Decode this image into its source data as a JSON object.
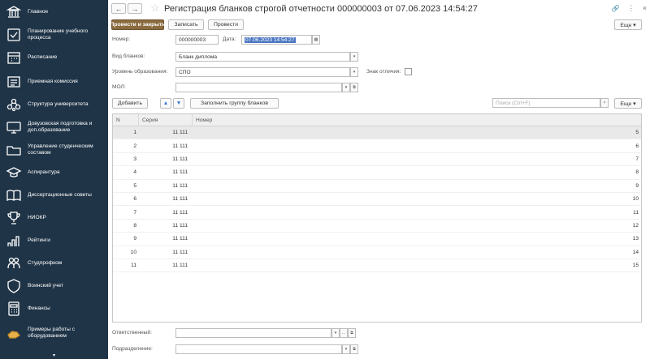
{
  "sidebar": {
    "items": [
      {
        "icon": "building-icon",
        "label": "Главное"
      },
      {
        "icon": "checkbox-icon",
        "label": "Планирование учебного процесса"
      },
      {
        "icon": "calendar-icon",
        "label": "Расписание"
      },
      {
        "icon": "list-icon",
        "label": "Приемная комиссия"
      },
      {
        "icon": "structure-icon",
        "label": "Структура университета"
      },
      {
        "icon": "monitor-icon",
        "label": "Довузовская подготовка и доп.образование"
      },
      {
        "icon": "folder-icon",
        "label": "Управление студенческим составом"
      },
      {
        "icon": "graduation-cap-icon",
        "label": "Аспирантура"
      },
      {
        "icon": "book-icon",
        "label": "Диссертационные советы"
      },
      {
        "icon": "trophy-icon",
        "label": "НИОКР"
      },
      {
        "icon": "bar-chart-icon",
        "label": "Рейтинги"
      },
      {
        "icon": "people-icon",
        "label": "Студпрофком"
      },
      {
        "icon": "shield-icon",
        "label": "Воинский учет"
      },
      {
        "icon": "calculator-icon",
        "label": "Финансы"
      },
      {
        "icon": "hand-icon",
        "label": "Примеры работы с оборудованием"
      }
    ],
    "more_icon": "▾"
  },
  "header": {
    "back": "←",
    "forward": "→",
    "star": "☆",
    "title": "Регистрация бланков строгой отчетности 000000003 от 07.06.2023 14:54:27",
    "link_icon": "🔗",
    "menu_icon": "⋮",
    "close_icon": "×"
  },
  "toolbar": {
    "post_close": "Провести и закрыть",
    "save": "Записать",
    "post": "Провести",
    "more": "Еще ▾"
  },
  "form": {
    "number_label": "Номер:",
    "number_value": "000000003",
    "date_label": "Дата:",
    "date_value": "07.06.2023 14:54:27",
    "blank_type_label": "Вид бланков:",
    "blank_type_value": "Бланк диплома",
    "edu_level_label": "Уровень образования:",
    "edu_level_value": "СПО",
    "honors_label": "Знак отличия:",
    "mol_label": "МОЛ:",
    "mol_value": "",
    "responsible_label": "Ответственный:",
    "responsible_value": "",
    "department_label": "Подразделение:",
    "department_value": ""
  },
  "table_toolbar": {
    "add": "Добавить",
    "up": "▲",
    "down": "▼",
    "fill": "Заполнить группу бланков",
    "search_placeholder": "Поиск (Ctrl+F)",
    "more": "Еще ▾"
  },
  "table": {
    "columns": [
      "N",
      "Серия",
      "Номер"
    ],
    "rows": [
      {
        "n": "1",
        "series": "11 111",
        "number": "5"
      },
      {
        "n": "2",
        "series": "11 111",
        "number": "6"
      },
      {
        "n": "3",
        "series": "11 111",
        "number": "7"
      },
      {
        "n": "4",
        "series": "11 111",
        "number": "8"
      },
      {
        "n": "5",
        "series": "11 111",
        "number": "9"
      },
      {
        "n": "6",
        "series": "11 111",
        "number": "10"
      },
      {
        "n": "7",
        "series": "11 111",
        "number": "11"
      },
      {
        "n": "8",
        "series": "11 111",
        "number": "12"
      },
      {
        "n": "9",
        "series": "11 111",
        "number": "13"
      },
      {
        "n": "10",
        "series": "11 111",
        "number": "14"
      },
      {
        "n": "11",
        "series": "11 111",
        "number": "15"
      }
    ],
    "selected_row": 0
  },
  "colors": {
    "sidebar_bg": "#1f3447",
    "primary_button": "#8a6b3f",
    "date_highlight": "#4a76c1"
  }
}
